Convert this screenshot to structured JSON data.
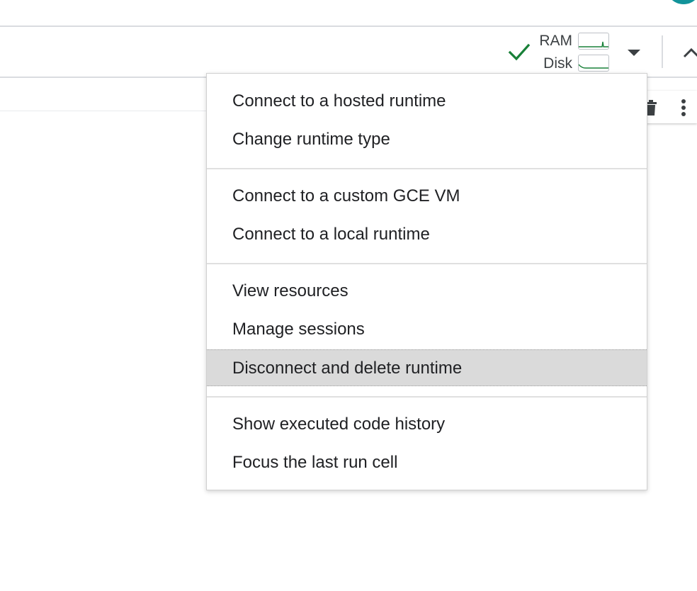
{
  "toolbar": {
    "ram_label": "RAM",
    "disk_label": "Disk",
    "status": "connected",
    "accent_color": "#188038"
  },
  "icons": {
    "status": "check-icon",
    "resources_menu": "caret-down-icon",
    "collapse": "chevron-up-icon",
    "delete_cell": "trash-icon",
    "more_actions": "kebab-icon"
  },
  "runtime_menu": {
    "items": [
      {
        "label": "Connect to a hosted runtime"
      },
      {
        "label": "Change runtime type"
      },
      {
        "label": "Connect to a custom GCE VM"
      },
      {
        "label": "Connect to a local runtime"
      },
      {
        "label": "View resources"
      },
      {
        "label": "Manage sessions"
      },
      {
        "label": "Disconnect and delete runtime",
        "highlighted": true
      },
      {
        "label": "Show executed code history"
      },
      {
        "label": "Focus the last run cell"
      }
    ]
  }
}
